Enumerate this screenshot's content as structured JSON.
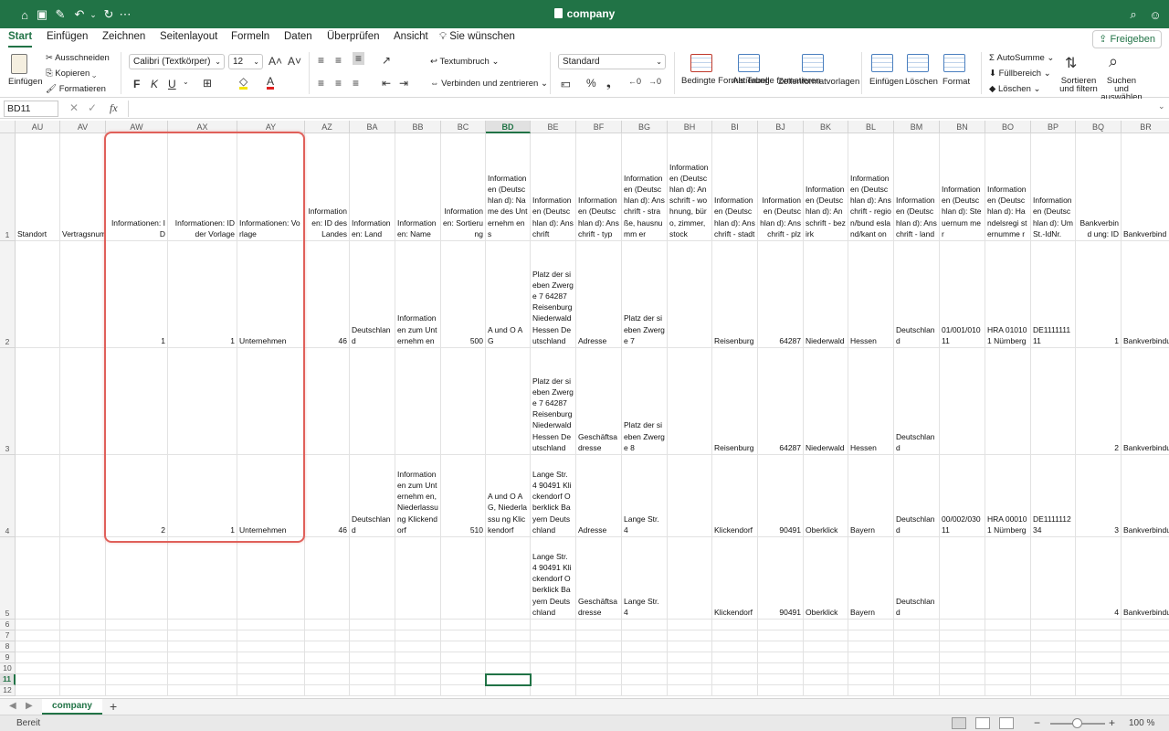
{
  "title_bar": {
    "doc_title": "company",
    "quick_access_icons": [
      "home-icon",
      "save-icon",
      "edit-icon",
      "undo-icon",
      "redo-icon",
      "more-icon"
    ],
    "right_icons": [
      "search-icon",
      "account-icon"
    ],
    "brand_color": "#217346"
  },
  "tabs": {
    "items": [
      "Start",
      "Einfügen",
      "Zeichnen",
      "Seitenlayout",
      "Formeln",
      "Daten",
      "Überprüfen",
      "Ansicht"
    ],
    "active": "Start",
    "tell_me": "Sie wünschen",
    "share": "Freigeben"
  },
  "ribbon": {
    "paste": "Einfügen",
    "cut": "Ausschneiden",
    "copy": "Kopieren",
    "format_painter": "Formatieren",
    "font_name": "Calibri (Textkörper)",
    "font_size": "12",
    "bold": "F",
    "italic": "K",
    "underline": "U",
    "wrap_text": "Textumbruch",
    "merge_center": "Verbinden und zentrieren",
    "number_format": "Standard",
    "conditional_formatting": "Bedingte Formatierung",
    "format_as_table": "Als Tabelle formatieren",
    "cell_styles": "Zellenformatvorlagen",
    "insert": "Einfügen",
    "delete": "Löschen",
    "format": "Format",
    "autosum": "AutoSumme",
    "fill": "Füllbereich",
    "clear": "Löschen",
    "sort_filter": "Sortieren und filtern",
    "find_select": "Suchen und auswählen"
  },
  "formula_bar": {
    "name_box": "BD11",
    "fx": "fx",
    "value": ""
  },
  "grid": {
    "columns": [
      {
        "key": "AU",
        "label": "AU"
      },
      {
        "key": "AV",
        "label": "AV"
      },
      {
        "key": "AW",
        "label": "AW"
      },
      {
        "key": "AX",
        "label": "AX"
      },
      {
        "key": "AY",
        "label": "AY"
      },
      {
        "key": "AZ",
        "label": "AZ"
      },
      {
        "key": "BA",
        "label": "BA"
      },
      {
        "key": "BB",
        "label": "BB"
      },
      {
        "key": "BC",
        "label": "BC"
      },
      {
        "key": "BD",
        "label": "BD"
      },
      {
        "key": "BE",
        "label": "BE"
      },
      {
        "key": "BF",
        "label": "BF"
      },
      {
        "key": "BG",
        "label": "BG"
      },
      {
        "key": "BH",
        "label": "BH"
      },
      {
        "key": "BI",
        "label": "BI"
      },
      {
        "key": "BJ",
        "label": "BJ"
      },
      {
        "key": "BK",
        "label": "BK"
      },
      {
        "key": "BL",
        "label": "BL"
      },
      {
        "key": "BM",
        "label": "BM"
      },
      {
        "key": "BN",
        "label": "BN"
      },
      {
        "key": "BO",
        "label": "BO"
      },
      {
        "key": "BP",
        "label": "BP"
      },
      {
        "key": "BQ",
        "label": "BQ"
      },
      {
        "key": "BR",
        "label": "BR"
      }
    ],
    "selected_column": "BD",
    "selected_cell": "BD11",
    "row_labels": [
      "1",
      "2",
      "3",
      "4",
      "5",
      "6",
      "7",
      "8",
      "9",
      "10",
      "11",
      "12"
    ],
    "selected_row": "11",
    "rows": [
      {
        "AU": "Standort",
        "AV": "Vertragsnum",
        "AW": "Informationen: ID",
        "AX": "Informationen: ID der Vorlage",
        "AY": "Informationen: Vorlage",
        "AZ": "Information en: ID des Landes",
        "BA": "Information en: Land",
        "BB": "Information en: Name",
        "BC": "Information en: Sortierung",
        "BD": "Information en (Deutschlan d): Name des Unternehm ens",
        "BE": "Information en (Deutschlan d): Anschrift",
        "BF": "Information en (Deutschlan d): Anschrift - typ",
        "BG": "Information en (Deutschlan d): Anschrift - straße, hausnumm er",
        "BH": "Information en (Deutschlan d): Anschrift - wohnung, büro, zimmer, stock",
        "BI": "Information en (Deutschlan d): Anschrift - stadt",
        "BJ": "Information en (Deutschlan d): Anschrift - plz",
        "BK": "Information en (Deutschlan d): Anschrift - bezirk",
        "BL": "Information en (Deutschlan d): Anschrift - region/bund esland/kant on",
        "BM": "Information en (Deutschlan d): Anschrift - land",
        "BN": "Information en (Deutschlan d): Steuernum mer",
        "BO": "Information en (Deutschlan d): Handelsregi sternumme r",
        "BP": "Information en (Deutschlan d): UmSt.-IdNr.",
        "BQ": "Bankverbind ung: ID",
        "BR": "Bankverbind ung: Name"
      },
      {
        "AU": "",
        "AV": "",
        "AW": "1",
        "AX": "1",
        "AY": "Unternehmen",
        "AZ": "46",
        "BA": "Deutschland",
        "BB": "Information en zum Unternehm en",
        "BC": "500",
        "BD": "A und O AG",
        "BE": "Platz der sieben Zwerge 7 64287 Reisenburg Niederwald Hessen Deutschland",
        "BF": "Adresse",
        "BG": "Platz der sieben Zwerge 7",
        "BH": "",
        "BI": "Reisenburg",
        "BJ": "64287",
        "BK": "Niederwald",
        "BL": "Hessen",
        "BM": "Deutschland",
        "BN": "01/001/010 11",
        "BO": "HRA 010101 Nürnberg",
        "BP": "DE1111111 11",
        "BQ": "1",
        "BR": "Bankverbindu"
      },
      {
        "AU": "",
        "AV": "",
        "AW": "",
        "AX": "",
        "AY": "",
        "AZ": "",
        "BA": "",
        "BB": "",
        "BC": "",
        "BD": "",
        "BE": "Platz der sieben Zwerge 7 64287 Reisenburg Niederwald Hessen Deutschland",
        "BF": "Geschäftsa dresse",
        "BG": "Platz der sieben Zwerge 8",
        "BH": "",
        "BI": "Reisenburg",
        "BJ": "64287",
        "BK": "Niederwald",
        "BL": "Hessen",
        "BM": "Deutschland",
        "BN": "",
        "BO": "",
        "BP": "",
        "BQ": "2",
        "BR": "Bankverbindu"
      },
      {
        "AU": "",
        "AV": "",
        "AW": "2",
        "AX": "1",
        "AY": "Unternehmen",
        "AZ": "46",
        "BA": "Deutschland",
        "BB": "Information en zum Unternehm en, Niederlassu ng Klickendorf",
        "BC": "510",
        "BD": "A und O AG, Niederlassu ng Klickendorf",
        "BE": "Lange Str. 4 90491 Klickendorf Oberklick Bayern Deutschland",
        "BF": "Adresse",
        "BG": "Lange Str. 4",
        "BH": "",
        "BI": "Klickendorf",
        "BJ": "90491",
        "BK": "Oberklick",
        "BL": "Bayern",
        "BM": "Deutschland",
        "BN": "00/002/030 11",
        "BO": "HRA 000101 Nürnberg",
        "BP": "DE1111112 34",
        "BQ": "3",
        "BR": "Bankverbindu"
      },
      {
        "AU": "",
        "AV": "",
        "AW": "",
        "AX": "",
        "AY": "",
        "AZ": "",
        "BA": "",
        "BB": "",
        "BC": "",
        "BD": "",
        "BE": "Lange Str. 4 90491 Klickendorf Oberklick Bayern Deutschland",
        "BF": "Geschäftsa dresse",
        "BG": "Lange Str. 4",
        "BH": "",
        "BI": "Klickendorf",
        "BJ": "90491",
        "BK": "Oberklick",
        "BL": "Bayern",
        "BM": "Deutschland",
        "BN": "",
        "BO": "",
        "BP": "",
        "BQ": "4",
        "BR": "Bankverbindu"
      }
    ],
    "numeric_columns": [
      "AW",
      "AX",
      "AZ",
      "BC",
      "BJ",
      "BQ"
    ]
  },
  "sheets": {
    "tabs": [
      "company"
    ],
    "active": "company",
    "add": "+"
  },
  "status_bar": {
    "ready": "Bereit",
    "zoom_minus": "−",
    "zoom_plus": "+",
    "zoom": "100 %",
    "zoom_fraction": 0.5
  }
}
